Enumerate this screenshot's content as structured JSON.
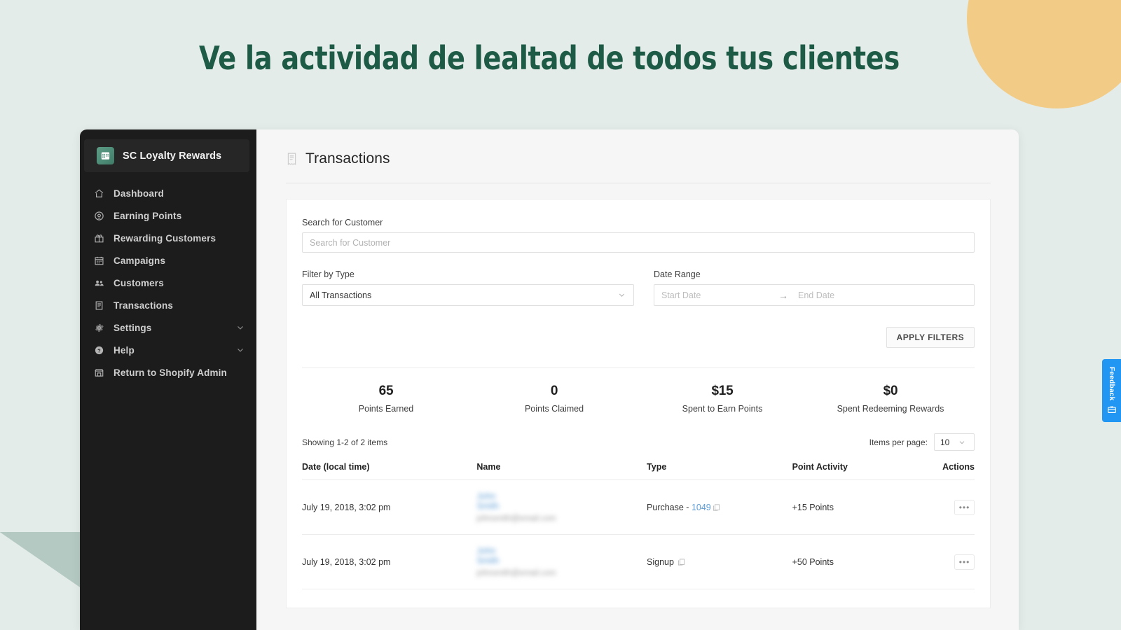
{
  "hero": {
    "title": "Ve la actividad de lealtad de todos tus clientes"
  },
  "colors": {
    "page_background": "#e4ecea",
    "hero_title": "#1e5b46",
    "deco_circle": "#f2cc87",
    "deco_triangle": "#b5c9c3",
    "sidebar": "#1c1c1c",
    "feedback_tab": "#2196f3",
    "link": "#5b9bd5",
    "points_positive": "#4fa24f",
    "brand_logo": "#4f8e79"
  },
  "sidebar": {
    "brand": {
      "name": "SC Loyalty Rewards",
      "icon": "calendar-grid-icon"
    },
    "items": [
      {
        "label": "Dashboard",
        "icon": "home-icon",
        "expandable": false
      },
      {
        "label": "Earning Points",
        "icon": "coin-icon",
        "expandable": false
      },
      {
        "label": "Rewarding Customers",
        "icon": "gift-icon",
        "expandable": false
      },
      {
        "label": "Campaigns",
        "icon": "calendar-icon",
        "expandable": false
      },
      {
        "label": "Customers",
        "icon": "people-icon",
        "expandable": false
      },
      {
        "label": "Transactions",
        "icon": "document-icon",
        "expandable": false
      },
      {
        "label": "Settings",
        "icon": "gear-icon",
        "expandable": true
      },
      {
        "label": "Help",
        "icon": "help-circle-icon",
        "expandable": true
      },
      {
        "label": "Return to Shopify Admin",
        "icon": "store-icon",
        "expandable": false
      }
    ]
  },
  "page": {
    "title": "Transactions",
    "icon": "receipt-icon"
  },
  "filters": {
    "search_label": "Search for Customer",
    "search_value": "",
    "search_placeholder": "Search for Customer",
    "type_label": "Filter by Type",
    "type_value": "All Transactions",
    "date_label": "Date Range",
    "date_start_placeholder": "Start Date",
    "date_end_placeholder": "End Date",
    "date_arrow": "→",
    "apply_label": "APPLY FILTERS"
  },
  "stats": [
    {
      "value": "65",
      "label": "Points Earned"
    },
    {
      "value": "0",
      "label": "Points Claimed"
    },
    {
      "value": "$15",
      "label": "Spent to Earn Points"
    },
    {
      "value": "$0",
      "label": "Spent Redeeming Rewards"
    }
  ],
  "list_meta": {
    "showing": "Showing 1-2 of 2 items",
    "per_page_label": "Items per page:",
    "per_page_value": "10"
  },
  "table": {
    "headers": {
      "date": "Date (local time)",
      "name": "Name",
      "type": "Type",
      "points": "Point Activity",
      "actions": "Actions"
    },
    "rows": [
      {
        "date": "July 19, 2018, 3:02 pm",
        "name": "John Smith",
        "email": "johnsmith@email.com",
        "type_text": "Purchase - ",
        "type_link": "1049",
        "points": "+15 Points",
        "action": "•••"
      },
      {
        "date": "July 19, 2018, 3:02 pm",
        "name": "John Smith",
        "email": "johnsmith@email.com",
        "type_text": "Signup ",
        "type_link": "",
        "points": "+50 Points",
        "action": "•••"
      }
    ]
  },
  "feedback": {
    "label": "Feedback",
    "icon": "feedback-box-icon"
  }
}
